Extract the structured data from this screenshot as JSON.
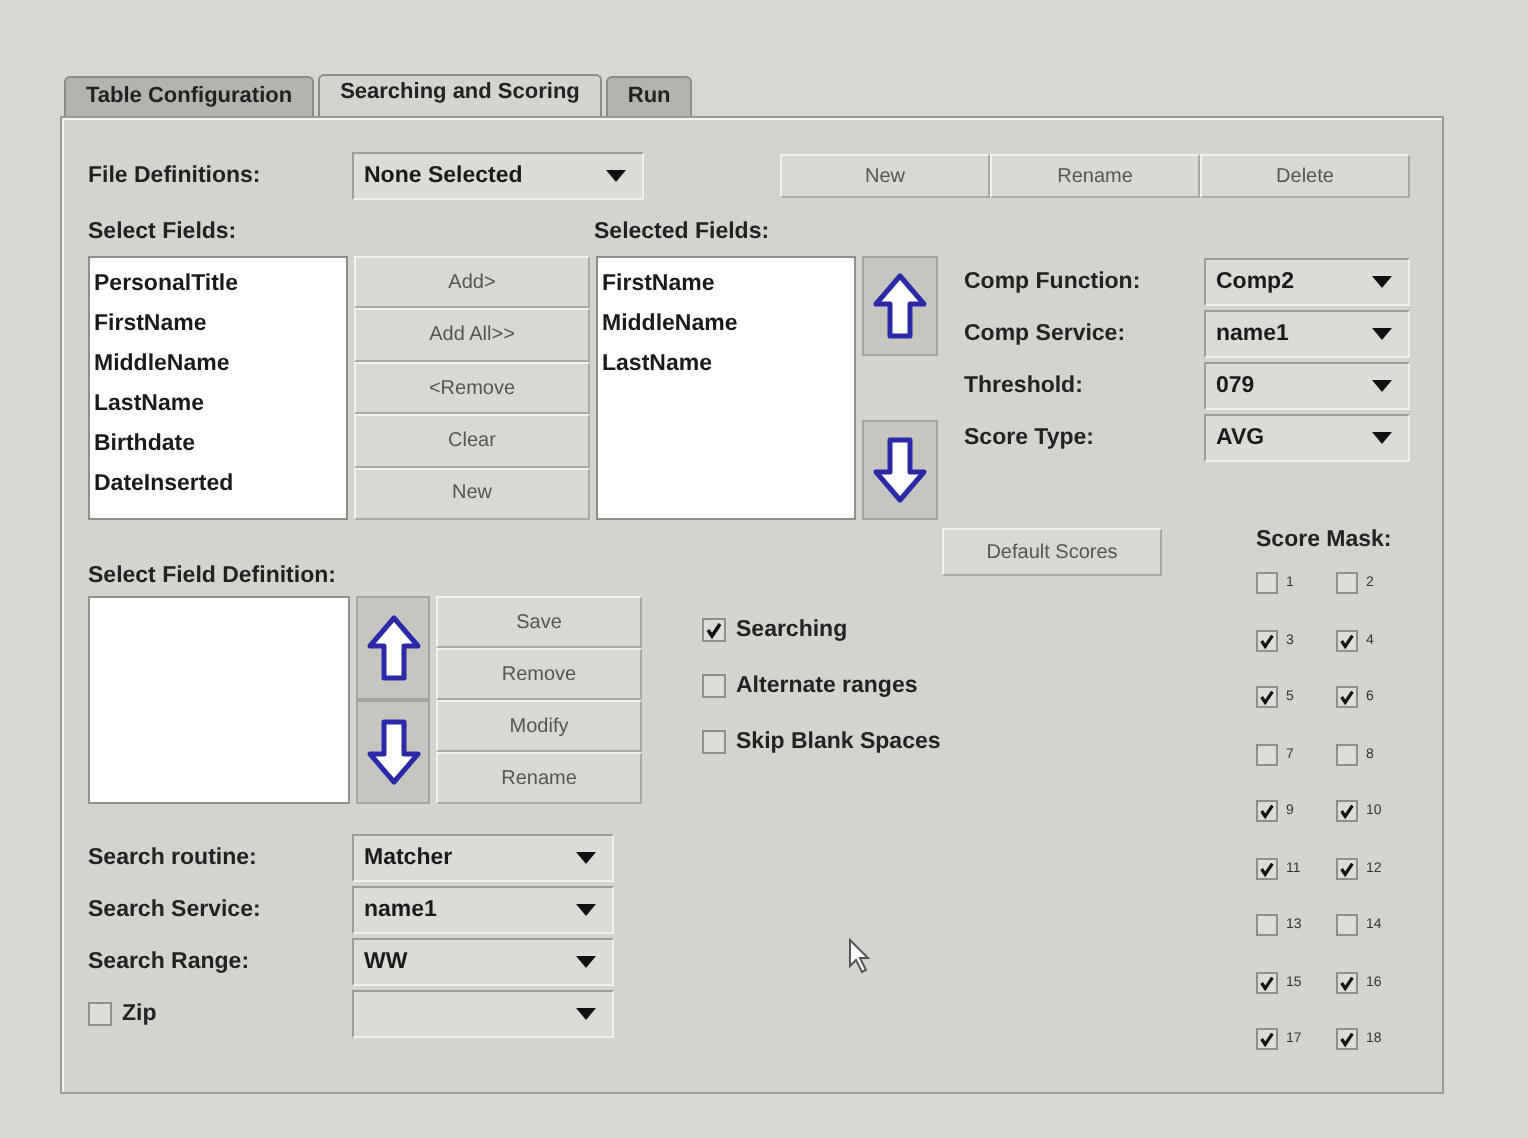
{
  "tabs": [
    {
      "label": "Table Configuration",
      "selected": false
    },
    {
      "label": "Searching and Scoring",
      "selected": true
    },
    {
      "label": "Run",
      "selected": false
    }
  ],
  "file_definitions": {
    "label": "File Definitions:",
    "value": "None Selected"
  },
  "file_buttons": [
    "New",
    "Rename",
    "Delete"
  ],
  "select_fields": {
    "label": "Select Fields:",
    "items": [
      "PersonalTitle",
      "FirstName",
      "MiddleName",
      "LastName",
      "Birthdate",
      "DateInserted"
    ]
  },
  "field_buttons": [
    "Add>",
    "Add All>>",
    "<Remove",
    "Clear",
    "New"
  ],
  "selected_fields": {
    "label": "Selected Fields:",
    "items": [
      "FirstName",
      "MiddleName",
      "LastName"
    ]
  },
  "comp_settings": [
    {
      "label": "Comp Function:",
      "value": "Comp2"
    },
    {
      "label": "Comp Service:",
      "value": "name1"
    },
    {
      "label": "Threshold:",
      "value": "079"
    },
    {
      "label": "Score Type:",
      "value": "AVG"
    }
  ],
  "default_scores_button": "Default Scores",
  "field_definition": {
    "label": "Select Field Definition:",
    "buttons": [
      "Save",
      "Remove",
      "Modify",
      "Rename"
    ]
  },
  "options": [
    {
      "label": "Searching",
      "checked": true
    },
    {
      "label": "Alternate ranges",
      "checked": false
    },
    {
      "label": "Skip Blank Spaces",
      "checked": false
    }
  ],
  "score_mask": {
    "label": "Score Mask:",
    "items": [
      {
        "label": "1",
        "checked": false
      },
      {
        "label": "2",
        "checked": false
      },
      {
        "label": "3",
        "checked": true
      },
      {
        "label": "4",
        "checked": true
      },
      {
        "label": "5",
        "checked": true
      },
      {
        "label": "6",
        "checked": true
      },
      {
        "label": "7",
        "checked": false
      },
      {
        "label": "8",
        "checked": false
      },
      {
        "label": "9",
        "checked": true
      },
      {
        "label": "10",
        "checked": true
      },
      {
        "label": "11",
        "checked": true
      },
      {
        "label": "12",
        "checked": true
      },
      {
        "label": "13",
        "checked": false
      },
      {
        "label": "14",
        "checked": false
      },
      {
        "label": "15",
        "checked": true
      },
      {
        "label": "16",
        "checked": true
      },
      {
        "label": "17",
        "checked": true
      },
      {
        "label": "18",
        "checked": true
      }
    ]
  },
  "search_settings": [
    {
      "kind": "label",
      "label": "Search routine:",
      "value": "Matcher"
    },
    {
      "kind": "label",
      "label": "Search Service:",
      "value": "name1"
    },
    {
      "kind": "label",
      "label": "Search Range:",
      "value": "WW"
    },
    {
      "kind": "checkbox",
      "label": "Zip",
      "checked": false
    }
  ]
}
